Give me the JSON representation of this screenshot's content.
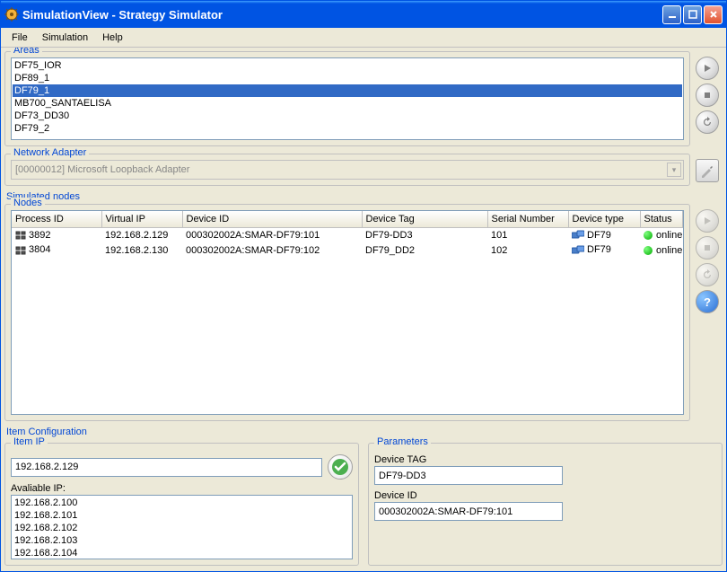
{
  "window": {
    "title": "SimulationView - Strategy Simulator"
  },
  "menu": {
    "file": "File",
    "simulation": "Simulation",
    "help": "Help"
  },
  "areas": {
    "title": "Areas",
    "items": [
      "DF75_IOR",
      "DF89_1",
      "DF79_1",
      "MB700_SANTAELISA",
      "DF73_DD30",
      "DF79_2"
    ],
    "selected_index": 2
  },
  "network_adapter": {
    "title": "Network Adapter",
    "value": "[00000012] Microsoft Loopback Adapter"
  },
  "simulated_nodes_label": "Simulated nodes",
  "nodes": {
    "title": "Nodes",
    "columns": [
      "Process ID",
      "Virtual IP",
      "Device ID",
      "Device Tag",
      "Serial Number",
      "Device type",
      "Status"
    ],
    "rows": [
      {
        "process_id": "3892",
        "virtual_ip": "192.168.2.129",
        "device_id": "000302002A:SMAR-DF79:101",
        "device_tag": "DF79-DD3",
        "serial": "101",
        "device_type": "DF79",
        "status": "online"
      },
      {
        "process_id": "3804",
        "virtual_ip": "192.168.2.130",
        "device_id": "000302002A:SMAR-DF79:102",
        "device_tag": "DF79_DD2",
        "serial": "102",
        "device_type": "DF79",
        "status": "online"
      }
    ]
  },
  "item_configuration_label": "Item Configuration",
  "item_ip": {
    "title": "Item IP",
    "value": "192.168.2.129",
    "available_label": "Avaliable IP:",
    "available": [
      "192.168.2.100",
      "192.168.2.101",
      "192.168.2.102",
      "192.168.2.103",
      "192.168.2.104"
    ]
  },
  "parameters": {
    "title": "Parameters",
    "device_tag_label": "Device TAG",
    "device_tag": "DF79-DD3",
    "device_id_label": "Device ID",
    "device_id": "000302002A:SMAR-DF79:101"
  }
}
